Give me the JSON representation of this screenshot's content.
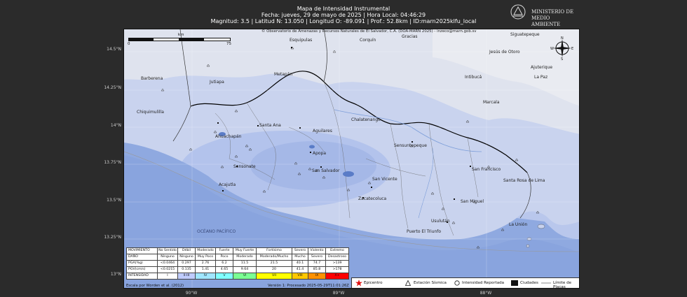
{
  "header": {
    "line1": "Mapa de Intensidad Instrumental",
    "line2": "Fecha: jueves, 29 de mayo de 2025 | Hora Local: 04:46:29",
    "line3": "Magnitud: 3.5 | Latitud N: 13.050 | Longitud O: -89.091 | Prof.: 52.8km | ID:marn2025klfu_local"
  },
  "logo": {
    "line1": "MINISTERIO DE",
    "line2": "MEDIO AMBIENTE"
  },
  "map": {
    "copyright": "© Observatorio de Amenazas y Recursos Naturales de El Salvador, C.A. (DOA-MARN 2025) - inzeco@marn.gob.sv",
    "scale": {
      "unit": "km",
      "min": "0",
      "max": "75"
    },
    "lat_labels": [
      "14.5°N",
      "14.25°N",
      "14°N",
      "13.75°N",
      "13.5°N",
      "13.25°N",
      "13°N"
    ],
    "lon_labels": [
      "90°W",
      "89°W",
      "88°W"
    ],
    "places": {
      "esquipulas": "Esquipulas",
      "corquin": "Corquín",
      "gracias": "Gracias",
      "siguatepeque": "Siguatepeque",
      "jesus_otoro": "Jesús de Otoro",
      "ajuterique": "Ajuterique",
      "la_paz": "La Paz",
      "barberena": "Barberena",
      "jutiapa": "Jutiapa",
      "metapan": "Metapán",
      "intibuca": "Intibucá",
      "marcala": "Marcala",
      "chiquimulilla": "Chiquimulilla",
      "chalatenango": "Chalatenango",
      "santa_ana": "Santa Ana",
      "ahuachapan": "Ahuachapán",
      "aguilares": "Aguilares",
      "sensuntepeque": "Sensuntepeque",
      "apopa": "Apopa",
      "sonsonate": "Sonsonate",
      "san_salvador": "San Salvador",
      "san_francisco": "San Francisco",
      "acajutla": "Acajutla",
      "san_vicente": "San Vicente",
      "santa_rosa": "Santa Rosa de Lima",
      "zacatecoluca": "Zacatecoluca",
      "san_miguel": "San Miguel",
      "oceano": "OCÉANO PACÍFICO",
      "usulutan": "Usulután",
      "la_union": "La Unión",
      "puerto_triunfo": "Puerto El Triunfo"
    },
    "compass": {
      "n": "N",
      "s": "S",
      "e": "E",
      "w": "W"
    }
  },
  "intensity_table": {
    "rows": [
      {
        "label": "MOVIMIENTO",
        "cells": [
          "No Sentido",
          "Débil",
          "Moderado",
          "Fuerte",
          "Muy Fuerte",
          "Fortísimo",
          "Severo",
          "Violento",
          "Extremo"
        ]
      },
      {
        "label": "DAÑO",
        "cells": [
          "Ninguno",
          "Ninguno",
          "Muy Poco",
          "Poco",
          "Moderado",
          "Moderado/Mucho",
          "Mucho",
          "Severo",
          "Desastroso"
        ]
      },
      {
        "label": "PGA(%g)",
        "cells": [
          "<0.0464",
          "0.297",
          "2.76",
          "6.2",
          "11.5",
          "21.5",
          "40.1",
          "74.7",
          ">139"
        ]
      },
      {
        "label": "PGV(cm/s)",
        "cells": [
          "<0.0215",
          "0.135",
          "1.41",
          "4.65",
          "9.64",
          "20",
          "41.4",
          "85.8",
          ">178"
        ]
      },
      {
        "label": "INTENSIDAD",
        "cells": [
          "I",
          "II-III",
          "IV",
          "V",
          "VI",
          "VII",
          "VIII",
          "IX",
          "X+"
        ]
      }
    ],
    "intensity_colors": [
      "#ffffff",
      "#bfccff",
      "#a0e6ff",
      "#80ffff",
      "#7aff93",
      "#ffff00",
      "#ffc800",
      "#ff9100",
      "#ff0000"
    ]
  },
  "captions": {
    "scale": "Escala por Worden et al. (2012)",
    "version": "Versión 1: Procesado 2025-05-29T11:01:26Z"
  },
  "legend": {
    "epicentro": "Epicentro",
    "estacion": "Estación Sísmica",
    "intensidad": "Intensidad Reportada",
    "ciudades": "Ciudades",
    "placas": "Límite de Placas"
  }
}
